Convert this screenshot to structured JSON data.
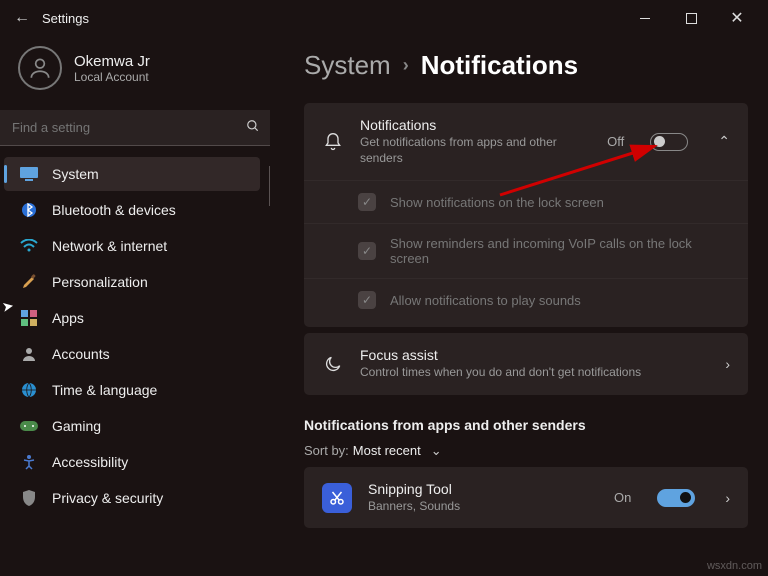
{
  "window": {
    "title": "Settings"
  },
  "user": {
    "name": "Okemwa Jr",
    "account": "Local Account"
  },
  "search": {
    "placeholder": "Find a setting"
  },
  "sidebar": {
    "items": [
      {
        "label": "System"
      },
      {
        "label": "Bluetooth & devices"
      },
      {
        "label": "Network & internet"
      },
      {
        "label": "Personalization"
      },
      {
        "label": "Apps"
      },
      {
        "label": "Accounts"
      },
      {
        "label": "Time & language"
      },
      {
        "label": "Gaming"
      },
      {
        "label": "Accessibility"
      },
      {
        "label": "Privacy & security"
      }
    ]
  },
  "breadcrumb": {
    "parent": "System",
    "current": "Notifications"
  },
  "notifications": {
    "title": "Notifications",
    "desc": "Get notifications from apps and other senders",
    "state_label": "Off",
    "opts": [
      "Show notifications on the lock screen",
      "Show reminders and incoming VoIP calls on the lock screen",
      "Allow notifications to play sounds"
    ]
  },
  "focus": {
    "title": "Focus assist",
    "desc": "Control times when you do and don't get notifications"
  },
  "apps_section": {
    "title": "Notifications from apps and other senders",
    "sort_label": "Sort by:",
    "sort_value": "Most recent"
  },
  "app1": {
    "name": "Snipping Tool",
    "desc": "Banners, Sounds",
    "state_label": "On"
  },
  "watermark": "wsxdn.com"
}
